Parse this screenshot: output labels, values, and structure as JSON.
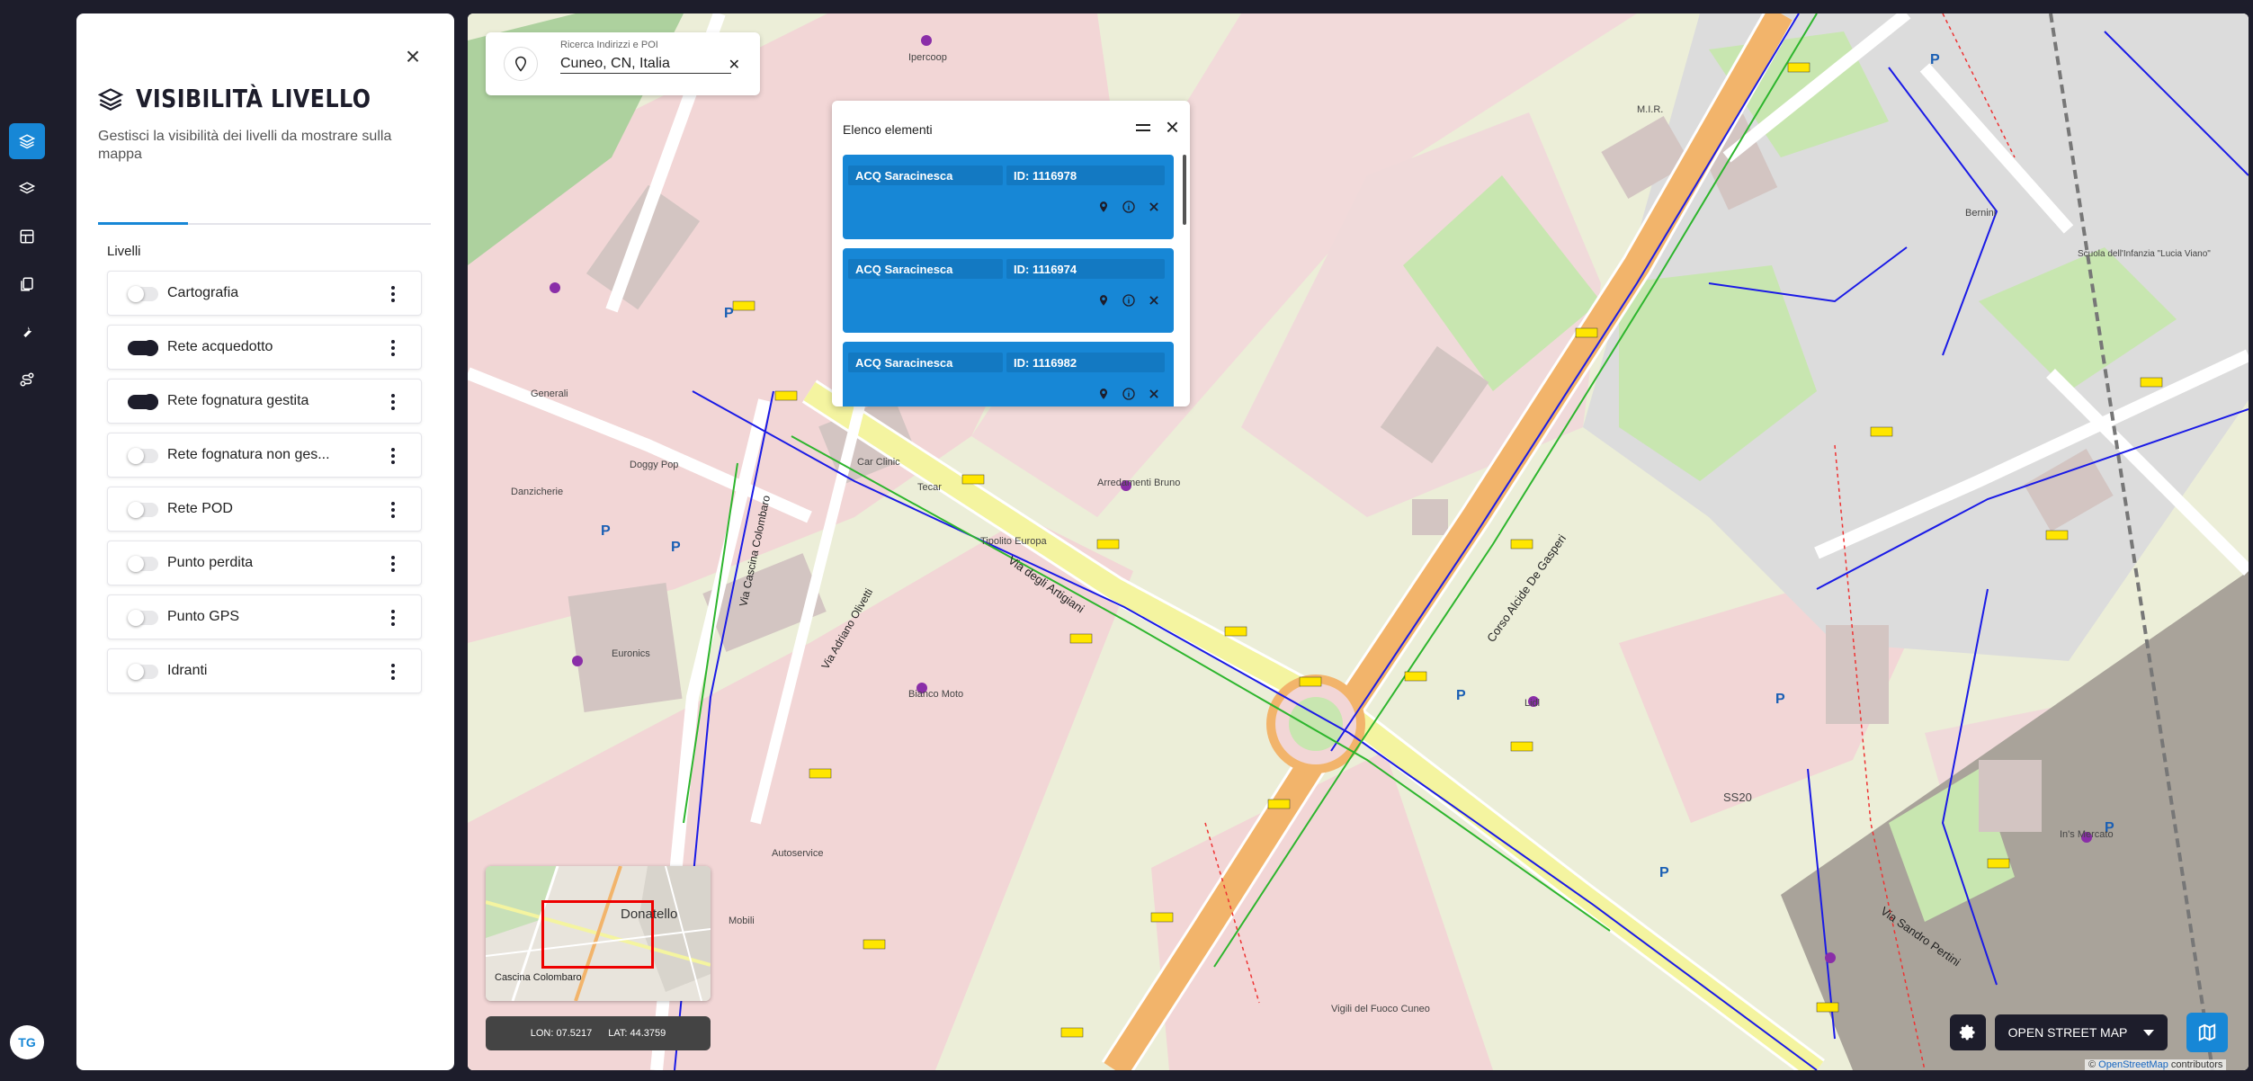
{
  "rail": {
    "items": [
      {
        "name": "layers-icon",
        "active": true
      },
      {
        "name": "stack-icon",
        "active": false
      },
      {
        "name": "dashboard-icon",
        "active": false
      },
      {
        "name": "documents-icon",
        "active": false
      },
      {
        "name": "wrench-icon",
        "active": false
      },
      {
        "name": "route-icon",
        "active": false
      }
    ],
    "avatar_initials": "TG"
  },
  "panel": {
    "title": "VISIBILITÀ LIVELLO",
    "subtitle": "Gestisci la visibilità dei livelli da mostrare sulla mappa",
    "section_label": "Livelli",
    "layers": [
      {
        "label": "Cartografia",
        "on": false
      },
      {
        "label": "Rete acquedotto",
        "on": true
      },
      {
        "label": "Rete fognatura gestita",
        "on": true
      },
      {
        "label": "Rete fognatura non ges...",
        "on": false
      },
      {
        "label": "Rete POD",
        "on": false
      },
      {
        "label": "Punto perdita",
        "on": false
      },
      {
        "label": "Punto GPS",
        "on": false
      },
      {
        "label": "Idranti",
        "on": false
      }
    ]
  },
  "search": {
    "caption": "Ricerca Indirizzi e POI",
    "value": "Cuneo, CN, Italia"
  },
  "element_list": {
    "title": "Elenco elementi",
    "items": [
      {
        "type": "ACQ Saracinesca",
        "id": "ID: 1116978"
      },
      {
        "type": "ACQ Saracinesca",
        "id": "ID: 1116974"
      },
      {
        "type": "ACQ Saracinesca",
        "id": "ID: 1116982"
      }
    ]
  },
  "minimap": {
    "label_town": "Donatello",
    "label_area": "Cascina Colombaro"
  },
  "coords": {
    "lon": "LON: 07.5217",
    "lat": "LAT: 44.3759"
  },
  "basemap": {
    "label": "OPEN STREET MAP"
  },
  "attribution": {
    "prefix": "©",
    "link": "OpenStreetMap",
    "suffix": "contributors"
  },
  "map_labels": {
    "street_1": "Via degli Artigiani",
    "street_2": "Corso Alcide De Gasperi",
    "street_3": "Via Sandro Pertini",
    "street_4": "Via Cascina Colombaro",
    "street_5": "Via Adriano Olivetti",
    "poi_1": "Euronics",
    "poi_2": "Lidl",
    "poi_3": "In's Mercato",
    "poi_4": "Autoservice",
    "poi_5": "Arredamenti Bruno",
    "poi_6": "Bianco Moto",
    "poi_7": "Vigili del Fuoco Cuneo",
    "poi_8": "Tipolito Europa",
    "poi_9": "Car Clinic",
    "poi_10": "Tecar",
    "poi_11": "Danzicherie",
    "poi_12": "Doggy Pop",
    "poi_13": "Generali",
    "poi_14": "Ipercoop",
    "poi_15": "M.I.R.",
    "poi_16": "Bernini",
    "poi_17": "Scuola dell'Infanzia \"Lucia Viano\"",
    "poi_18": "SS20",
    "poi_19": "Mobili"
  },
  "colors": {
    "accent": "#1787d6",
    "dark": "#1d1d2b",
    "water_network": "#1a1ae6",
    "main_road": "#f2b46b",
    "secondary_road": "#f4f4a0"
  }
}
